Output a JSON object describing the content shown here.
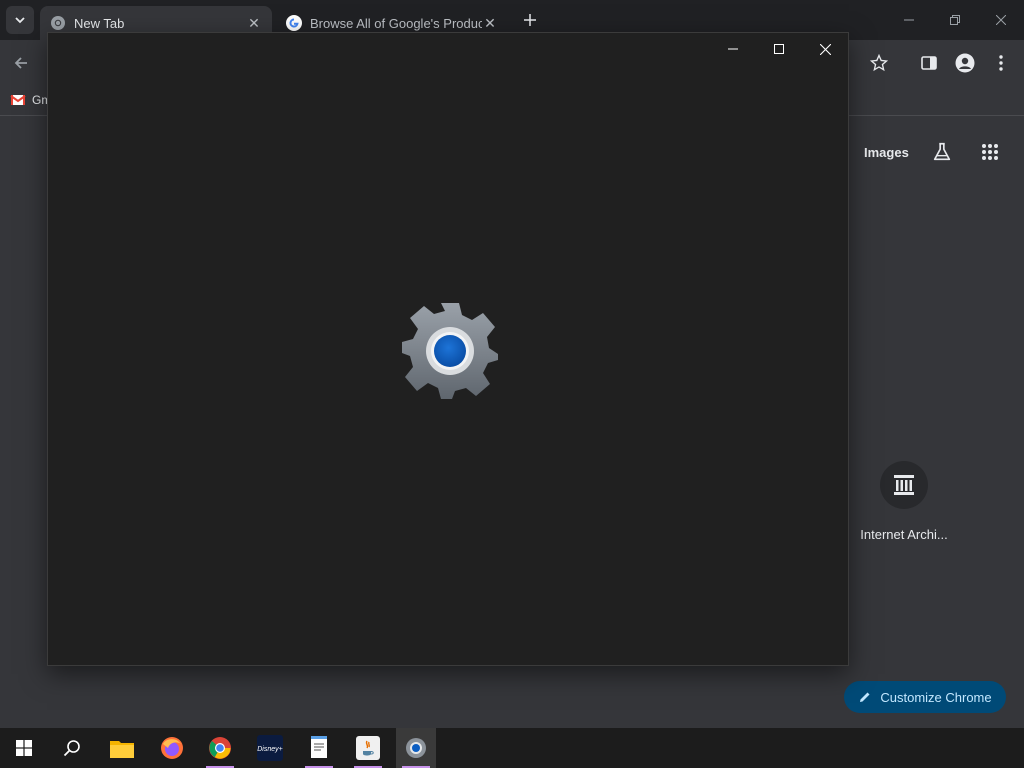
{
  "browser": {
    "tabs": [
      {
        "title": "New Tab",
        "active": true,
        "favicon": "chrome-icon"
      },
      {
        "title": "Browse All of Google's Products",
        "active": false,
        "favicon": "google-icon"
      }
    ],
    "bookmarks": [
      {
        "label": "Gm",
        "favicon": "gmail-icon"
      }
    ],
    "new_tab_page": {
      "images_link": "Images",
      "shortcut_label": "Internet Archi...",
      "customize_label": "Customize Chrome"
    }
  },
  "colors": {
    "chrome_bg": "#35363a",
    "tabstrip_bg": "#202124",
    "splash_bg": "#202020",
    "customize_btn_bg": "#004a77",
    "gear_accent": "#0a5dc2"
  },
  "taskbar": {
    "apps": [
      {
        "name": "start-icon"
      },
      {
        "name": "search-icon"
      },
      {
        "name": "file-explorer-icon"
      },
      {
        "name": "firefox-icon"
      },
      {
        "name": "chrome-icon"
      },
      {
        "name": "disney-plus-icon"
      },
      {
        "name": "notepad-icon"
      },
      {
        "name": "java-icon"
      },
      {
        "name": "settings-icon"
      }
    ]
  }
}
